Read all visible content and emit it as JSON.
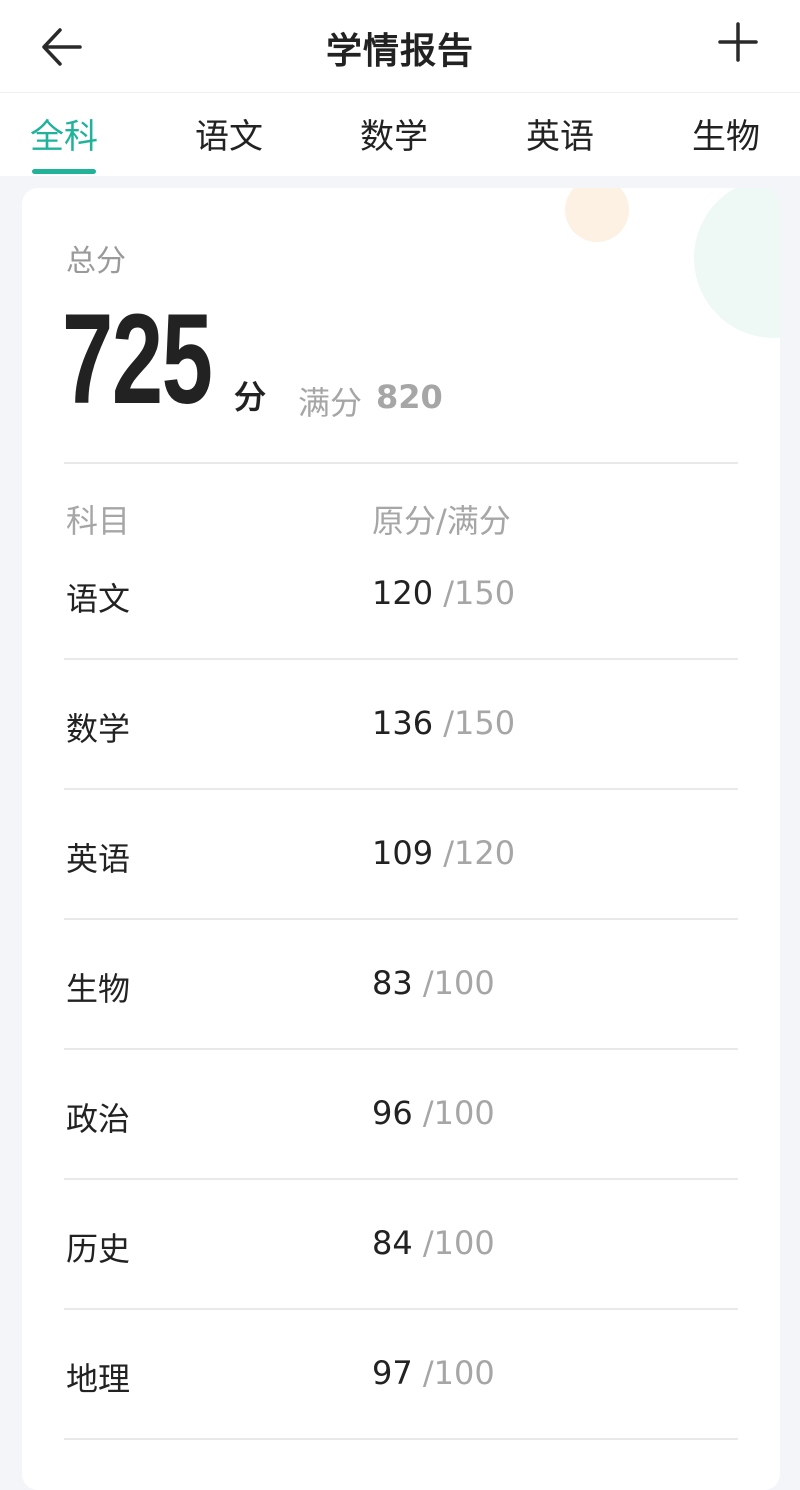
{
  "header": {
    "title": "学情报告"
  },
  "tabs": [
    {
      "label": "全科",
      "active": true
    },
    {
      "label": "语文",
      "active": false
    },
    {
      "label": "数学",
      "active": false
    },
    {
      "label": "英语",
      "active": false
    },
    {
      "label": "生物",
      "active": false
    }
  ],
  "summary": {
    "total_label": "总分",
    "total_score": "725",
    "unit": "分",
    "full_label": "满分",
    "full_score": "820"
  },
  "table": {
    "headers": [
      "科目",
      "原分/满分"
    ],
    "rows": [
      {
        "subject": "语文",
        "score": "120",
        "full": "/150"
      },
      {
        "subject": "数学",
        "score": "136",
        "full": "/150"
      },
      {
        "subject": "英语",
        "score": "109",
        "full": "/120"
      },
      {
        "subject": "生物",
        "score": "83",
        "full": "/100"
      },
      {
        "subject": "政治",
        "score": "96",
        "full": "/100"
      },
      {
        "subject": "历史",
        "score": "84",
        "full": "/100"
      },
      {
        "subject": "地理",
        "score": "97",
        "full": "/100"
      }
    ]
  },
  "colors": {
    "accent": "#20b39a",
    "text": "#222222",
    "muted": "#a6a6a6",
    "background": "#f4f5f9"
  },
  "icons": {
    "back": "arrow-left-icon",
    "add": "plus-icon"
  }
}
